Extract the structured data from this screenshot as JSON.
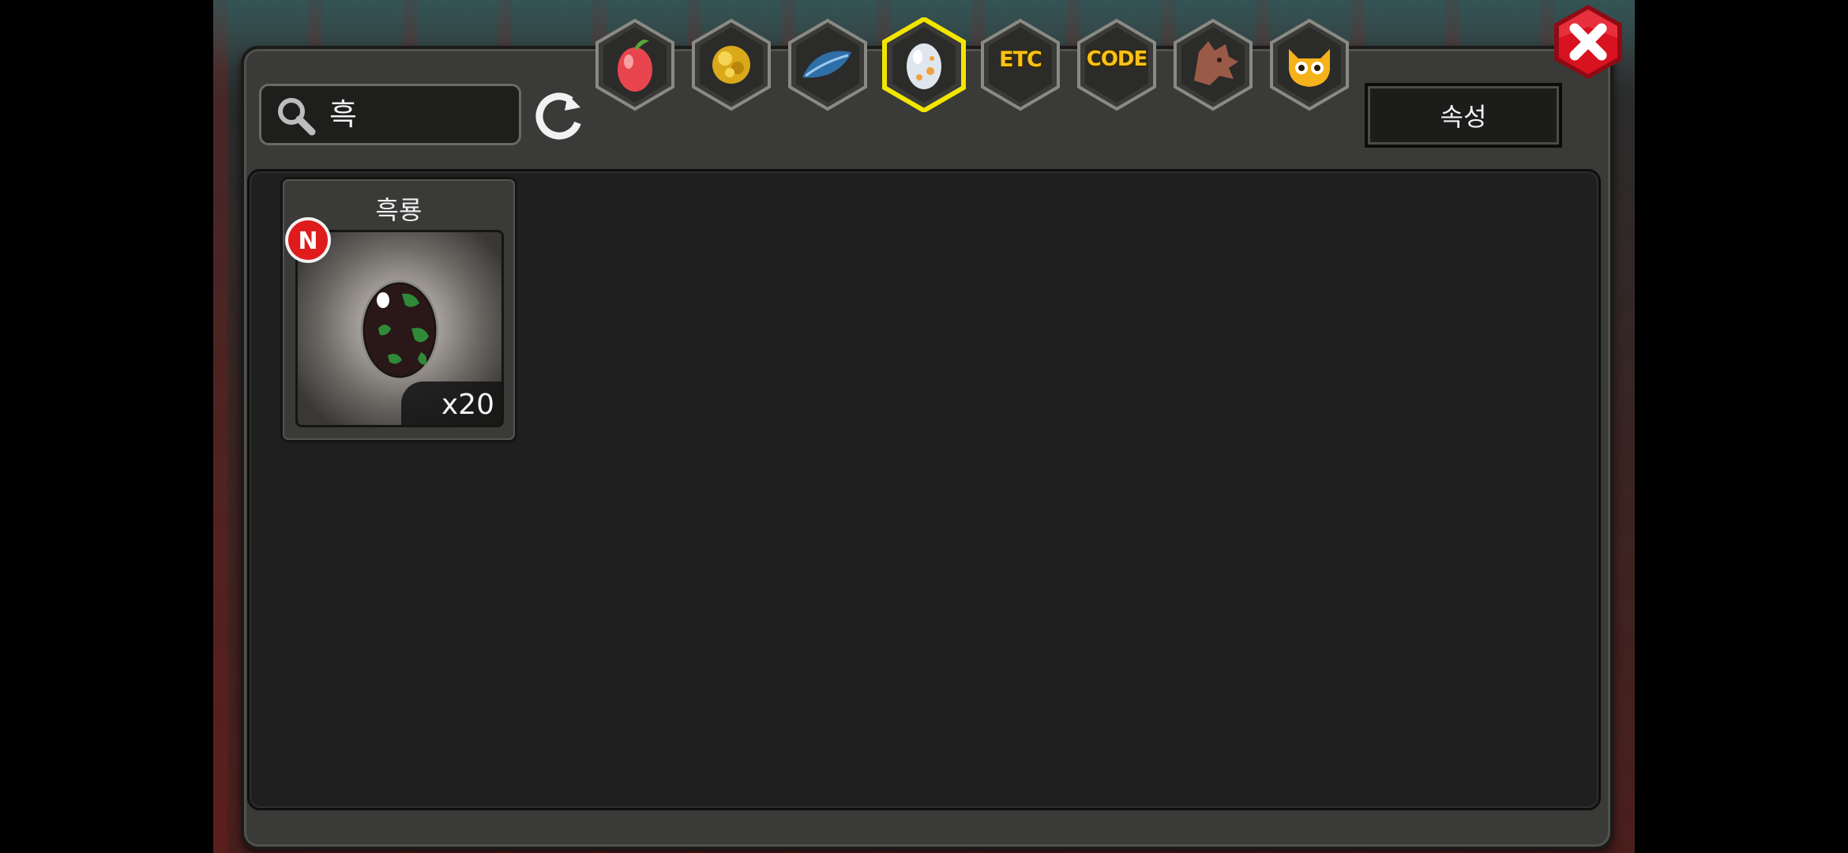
{
  "search": {
    "value": "흑"
  },
  "tabs": [
    {
      "name": "fruit",
      "icon": "fruit-icon"
    },
    {
      "name": "gold",
      "icon": "gold-nugget-icon"
    },
    {
      "name": "feather",
      "icon": "blue-feather-icon"
    },
    {
      "name": "egg",
      "icon": "egg-icon",
      "selected": true
    },
    {
      "name": "etc",
      "label": "ETC"
    },
    {
      "name": "code",
      "label": "CODE"
    },
    {
      "name": "dragon",
      "icon": "dragon-head-icon"
    },
    {
      "name": "pet",
      "icon": "pet-face-icon"
    }
  ],
  "attribute_button": {
    "label": "속성"
  },
  "items": [
    {
      "name": "흑룡",
      "quantity": "x20",
      "badge": "N",
      "icon": "black-dragon-egg-icon"
    }
  ],
  "colors": {
    "panel": "#3a3a38",
    "content": "#1f1f1f",
    "tab_selected_border": "#f2e600",
    "tab_text": "#f8c21a",
    "close_red": "#d9121f",
    "new_badge_red": "#e01b1b"
  }
}
